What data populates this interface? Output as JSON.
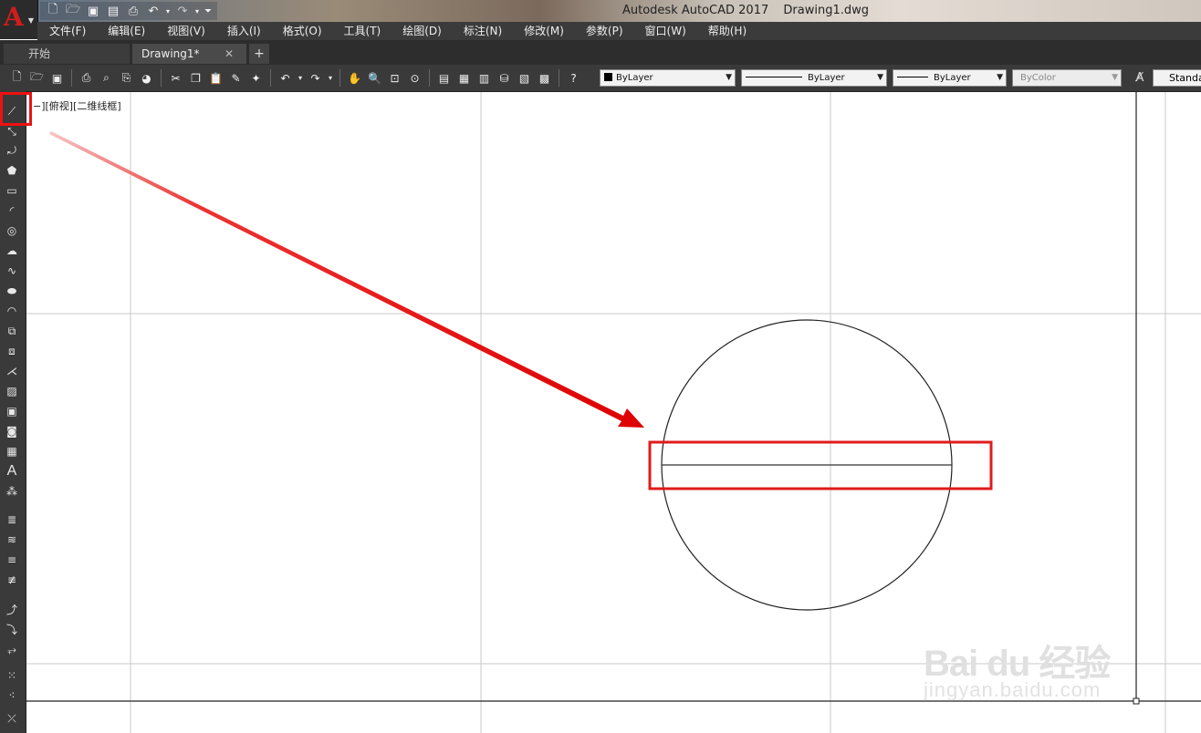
{
  "title_bar": {
    "app_name": "Autodesk AutoCAD 2017",
    "file_name": "Drawing1.dwg",
    "logo_letter": "A"
  },
  "quick_access_icons": [
    "new-icon",
    "open-icon",
    "save-icon",
    "save-as-icon",
    "plot-icon",
    "undo-icon",
    "redo-icon",
    "customize-icon"
  ],
  "menu": {
    "items": [
      "文件(F)",
      "编辑(E)",
      "视图(V)",
      "插入(I)",
      "格式(O)",
      "工具(T)",
      "绘图(D)",
      "标注(N)",
      "修改(M)",
      "参数(P)",
      "窗口(W)",
      "帮助(H)"
    ]
  },
  "tabs": {
    "start": "开始",
    "drawing": "Drawing1*",
    "close": "✕",
    "add": "+"
  },
  "properties": {
    "color": "ByLayer",
    "linetype": "ByLayer",
    "lineweight": "ByLayer",
    "plot_style": "ByColor",
    "text_style": "Standa"
  },
  "viewport": {
    "label": "−][俯视][二维线框]"
  },
  "watermark": {
    "brand": "Bai du 经验",
    "url": "jingyan.baidu.com"
  },
  "colors": {
    "highlight": "#e11b1b",
    "ui_dark": "#3a3a3a",
    "canvas": "#ffffff"
  }
}
